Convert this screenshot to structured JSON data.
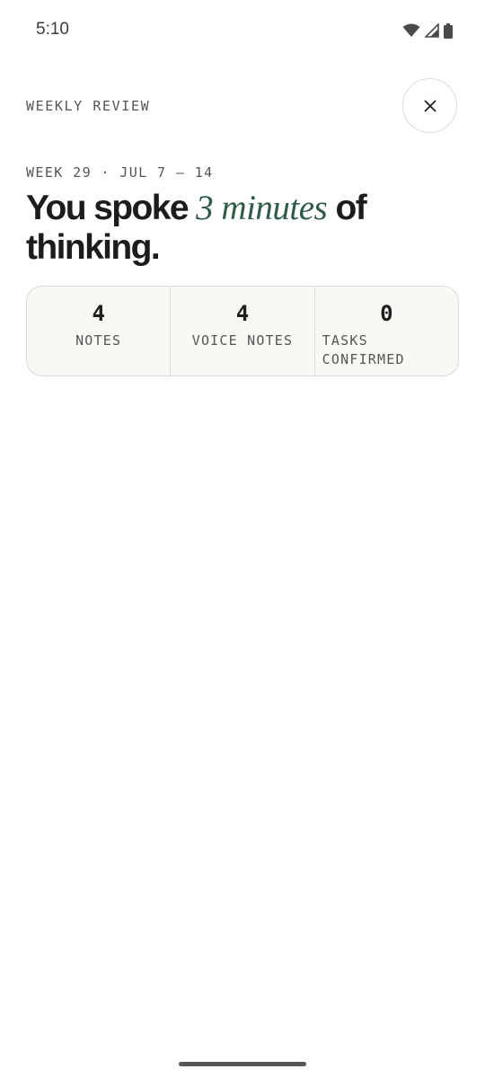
{
  "status_bar": {
    "time": "5:10",
    "icons": [
      "wifi-icon",
      "cell-signal-icon",
      "battery-icon"
    ]
  },
  "header": {
    "label": "WEEKLY REVIEW",
    "close_icon": "close-icon"
  },
  "review": {
    "week_label": "WEEK 29 · JUL 7 – 14",
    "headline_prefix": "You spoke ",
    "headline_accent": "3 minutes",
    "headline_suffix": " of thinking."
  },
  "stats": [
    {
      "value": "4",
      "label": "NOTES"
    },
    {
      "value": "4",
      "label": "VOICE NOTES"
    },
    {
      "value": "0",
      "label": "TASKS CONFIRMED"
    }
  ],
  "colors": {
    "accent": "#2f5a45",
    "card_background": "#f9f8f5",
    "card_border": "#dcdad3",
    "text": "#1c1c1c",
    "muted_text": "#555555"
  }
}
